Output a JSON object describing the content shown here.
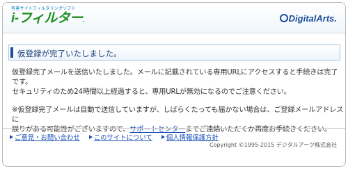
{
  "header": {
    "brand_tag": "有害サイトフィルタリングソフト",
    "brand_name": "i-フィルター",
    "brand_dot": ".",
    "corp_name": "DigitalArts."
  },
  "notice": {
    "text": "仮登録が完了いたしました。"
  },
  "body": {
    "para1_line1": "仮登録完了メールを送信いたしました。メールに記載されている専用URLにアクセスすると手続きは完了です。",
    "para1_line2": "セキュリティのため24時間以上経過すると、専用URLが無効になるのでご注意ください。",
    "para2_line1": "※仮登録完了メールは自動で送信していますが、しばらくたっても届かない場合は、ご登録メールアドレスに",
    "para2_line2_a": "誤りがある可能性がございますので、",
    "para2_link": "サポートセンター",
    "para2_line2_b": "までご連絡いただくか再度お手続きください。"
  },
  "footer": {
    "links": [
      "ご意見・お問い合わせ",
      "このサイトについて",
      "個人情報保護方針"
    ],
    "copyright": "Copyright ©1995-2015 デジタルアーツ株式会社"
  },
  "colors": {
    "brand_green": "#1f8f22",
    "corp_blue": "#1a4f9a",
    "link_blue": "#1a4fb8"
  }
}
